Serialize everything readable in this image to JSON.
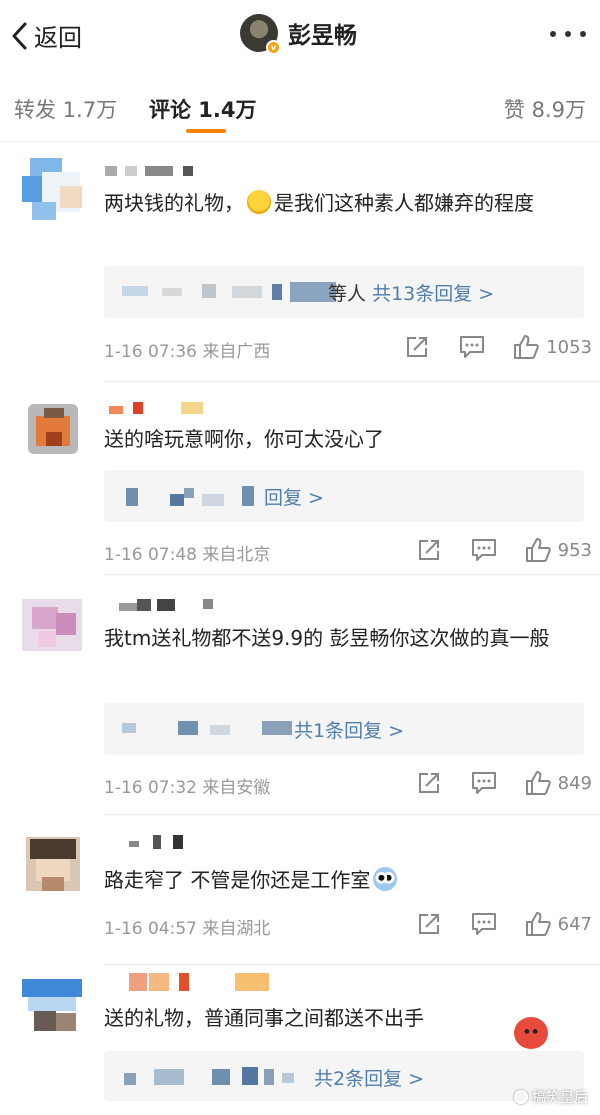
{
  "nav": {
    "back_label": "返回",
    "title": "彭昱畅",
    "verified_badge": "v"
  },
  "tabs": {
    "repost": "转发 1.7万",
    "comment": "评论 1.4万",
    "like": "赞 8.9万"
  },
  "comments": [
    {
      "text": "两块钱的礼物，😂是我们这种素人都嫌弃的程度",
      "text_before_emoji": "两块钱的礼物，",
      "text_after_emoji": "是我们这种素人都嫌弃的程度",
      "reply_partial": "等人",
      "reply_link": "共13条回复 >",
      "time_location": "1-16 07:36 来自广西",
      "likes": "1053"
    },
    {
      "text": "送的啥玩意啊你，你可太没心了",
      "reply_link": "回复 >",
      "time_location": "1-16 07:48 来自北京",
      "likes": "953"
    },
    {
      "text": "我tm送礼物都不送9.9的 彭昱畅你这次做的真一般",
      "reply_link": "共1条回复 >",
      "time_location": "1-16 07:32 来自安徽",
      "likes": "849"
    },
    {
      "text": "路走窄了 不管是你还是工作室",
      "time_location": "1-16 04:57 来自湖北",
      "likes": "647"
    },
    {
      "text": "送的礼物，普通同事之间都送不出手",
      "reply_link": "共2条回复 >"
    }
  ],
  "watermark": "搞笑皇后",
  "colors": {
    "accent": "#ff8200",
    "link": "#507daf",
    "meta": "#999999"
  }
}
